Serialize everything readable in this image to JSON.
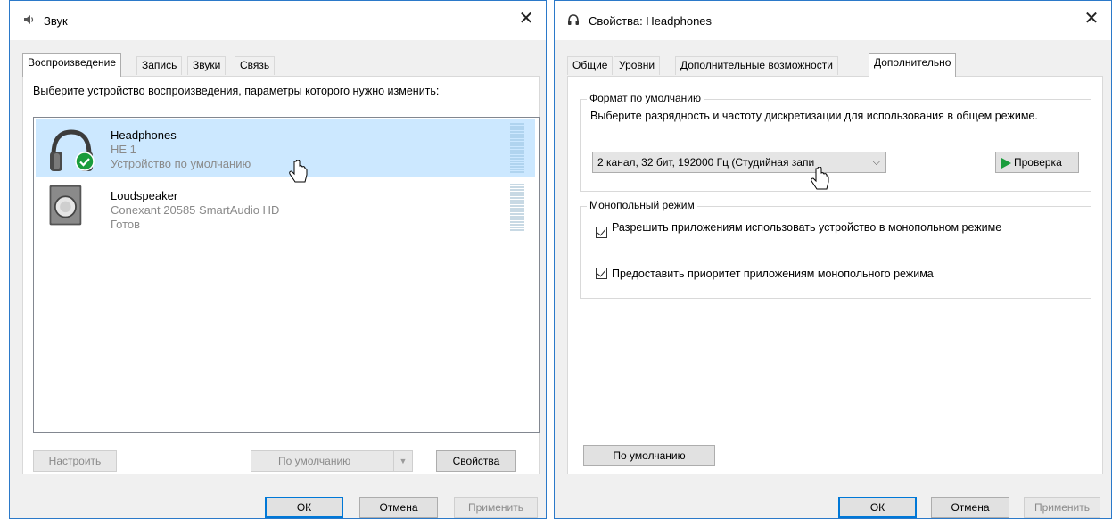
{
  "left_window": {
    "title": "Звук",
    "tabs": [
      "Воспроизведение",
      "Запись",
      "Звуки",
      "Связь"
    ],
    "instruction": "Выберите устройство воспроизведения, параметры которого нужно изменить:",
    "devices": [
      {
        "name": "Headphones",
        "line1": "HE 1",
        "line2": "Устройство по умолчанию",
        "selected": true,
        "icon": "headphones-icon",
        "default_badge": "checkmark-icon"
      },
      {
        "name": "Loudspeaker",
        "line1": "Conexant 20585 SmartAudio HD",
        "line2": "Готов",
        "selected": false,
        "icon": "speaker-icon"
      }
    ],
    "buttons": {
      "configure": "Настроить",
      "set_default": "По умолчанию",
      "properties": "Свойства",
      "ok": "ОК",
      "cancel": "Отмена",
      "apply": "Применить"
    }
  },
  "right_window": {
    "title": "Свойства: Headphones",
    "tabs": [
      "Общие",
      "Уровни",
      "Дополнительные возможности",
      "Дополнительно"
    ],
    "default_format": {
      "legend": "Формат по умолчанию",
      "description": "Выберите разрядность и частоту дискретизации для использования в общем режиме.",
      "selected_format": "2 канал, 32 бит, 192000 Гц (Студийная запи",
      "test_button": "Проверка"
    },
    "exclusive_mode": {
      "legend": "Монопольный режим",
      "allow_label": "Разрешить приложениям использовать устройство в монопольном режиме",
      "allow_checked": true,
      "priority_label": "Предоставить приоритет приложениям монопольного режима",
      "priority_checked": true
    },
    "buttons": {
      "restore_defaults": "По умолчанию",
      "ok": "ОК",
      "cancel": "Отмена",
      "apply": "Применить"
    }
  },
  "colors": {
    "accent": "#0078d7",
    "selection": "#cce8ff",
    "window_border": "#2b79c9",
    "play_green": "#1a9c3c"
  }
}
